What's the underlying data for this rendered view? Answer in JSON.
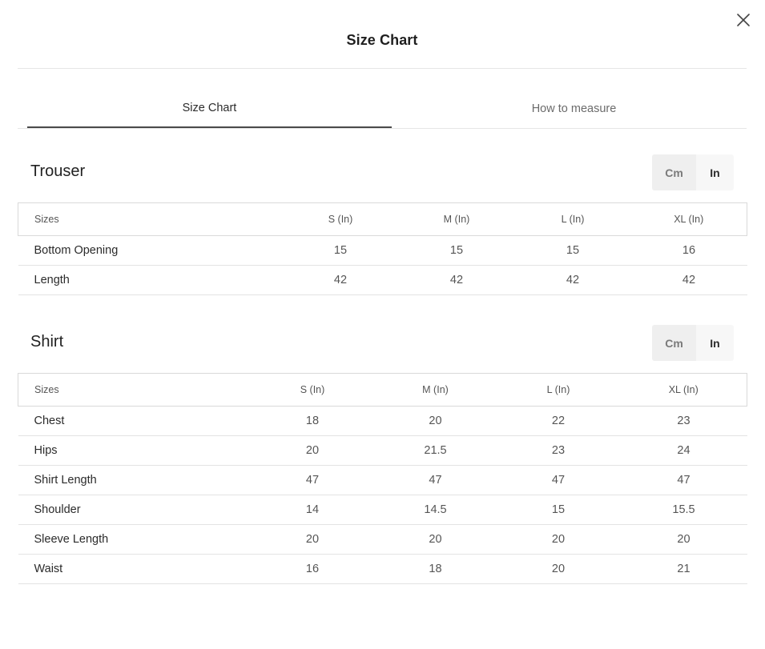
{
  "modal": {
    "title": "Size Chart",
    "close_icon": "close-icon"
  },
  "tabs": [
    {
      "label": "Size Chart",
      "active": true
    },
    {
      "label": "How to measure",
      "active": false
    }
  ],
  "unit_options": {
    "cm": "Cm",
    "in": "In",
    "selected": "In"
  },
  "trouser": {
    "title": "Trouser",
    "headers": [
      "Sizes",
      "S (In)",
      "M (In)",
      "L (In)",
      "XL (In)"
    ],
    "rows": [
      [
        "Bottom Opening",
        "15",
        "15",
        "15",
        "16"
      ],
      [
        "Length",
        "42",
        "42",
        "42",
        "42"
      ]
    ]
  },
  "shirt": {
    "title": "Shirt",
    "headers": [
      "Sizes",
      "S (In)",
      "M (In)",
      "L (In)",
      "XL (In)"
    ],
    "rows": [
      [
        "Chest",
        "18",
        "20",
        "22",
        "23"
      ],
      [
        "Hips",
        "20",
        "21.5",
        "23",
        "24"
      ],
      [
        "Shirt Length",
        "47",
        "47",
        "47",
        "47"
      ],
      [
        "Shoulder",
        "14",
        "14.5",
        "15",
        "15.5"
      ],
      [
        "Sleeve Length",
        "20",
        "20",
        "20",
        "20"
      ],
      [
        "Waist",
        "16",
        "18",
        "20",
        "21"
      ]
    ]
  }
}
